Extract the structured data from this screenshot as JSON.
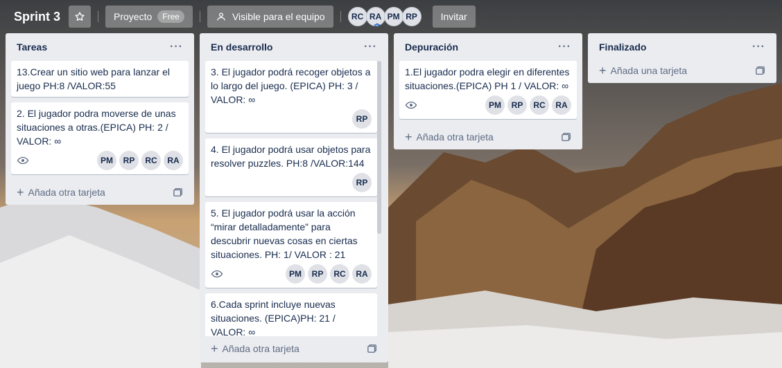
{
  "header": {
    "board_title": "Sprint 3",
    "star_icon": "star-icon",
    "workspace_label": "Proyecto",
    "workspace_badge": "Free",
    "visibility_icon": "team-icon",
    "visibility_label": "Visible para el equipo",
    "members": [
      "RC",
      "RA",
      "PM",
      "RP"
    ],
    "invite_label": "Invitar"
  },
  "lists": [
    {
      "title": "Tareas",
      "menu": "···",
      "cards": [
        {
          "text": "13.Crear un sitio web para lanzar el juego PH:8 /VALOR:55",
          "watch": false,
          "members": []
        },
        {
          "text": "2. El jugador podra moverse de unas situaciones a otras.(EPICA) PH: 2 / VALOR: ∞",
          "watch": true,
          "members": [
            "PM",
            "RP",
            "RC",
            "RA"
          ]
        }
      ],
      "add_label": "Añada otra tarjeta"
    },
    {
      "title": "En desarrollo",
      "menu": "···",
      "cards": [
        {
          "text": "3. El jugador podrá recoger objetos a lo largo del juego. (EPICA) PH: 3 / VALOR: ∞",
          "watch": false,
          "members": [
            "RP"
          ]
        },
        {
          "text": "4. El jugador podrá usar objetos para resolver puzzles. PH:8 /VALOR:144",
          "watch": false,
          "members": [
            "RP"
          ]
        },
        {
          "text": "5. El jugador podrá usar la acción “mirar detalladamente” para descubrir nuevas cosas en ciertas situaciones. PH: 1/ VALOR : 21",
          "watch": true,
          "members": [
            "PM",
            "RP",
            "RC",
            "RA"
          ]
        },
        {
          "text": "6.Cada sprint incluye nuevas situaciones. (EPICA)PH: 21 / VALOR: ∞",
          "watch": false,
          "members": []
        }
      ],
      "add_label": "Añada otra tarjeta"
    },
    {
      "title": "Depuración",
      "menu": "···",
      "cards": [
        {
          "text": "1.El jugador podra elegir en diferentes situaciones.(EPICA) PH 1 / VALOR: ∞",
          "watch": true,
          "members": [
            "PM",
            "RP",
            "RC",
            "RA"
          ]
        }
      ],
      "add_label": "Añada otra tarjeta"
    },
    {
      "title": "Finalizado",
      "menu": "···",
      "cards": [],
      "add_label": "Añada una tarjeta"
    }
  ],
  "colors": {
    "list_bg": "#ebecf0",
    "card_bg": "#ffffff",
    "text": "#172b4d",
    "muted": "#5e6c84"
  }
}
